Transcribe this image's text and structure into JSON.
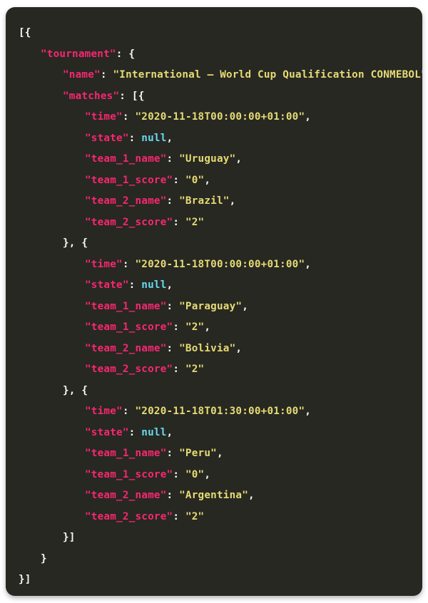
{
  "viewer": {
    "language": "json",
    "theme_name": "monokai",
    "colors": {
      "background": "#272822",
      "key": "#f92672",
      "string": "#e6db74",
      "null_literal": "#66d9ef",
      "punctuation": "#f8f8f2"
    }
  },
  "syntax": {
    "quote": "\"",
    "colon": ": ",
    "comma": ",",
    "open_array_object": "[{",
    "close_object_open_object": "}, {",
    "close_object_array": "}]",
    "close_brace": "}",
    "open_brace": " {",
    "open_array": " [{",
    "null_text": "null"
  },
  "document": {
    "root_open": "[{",
    "tournament_key": "tournament",
    "name_key": "name",
    "name_value": "International – World Cup Qualification CONMEBOL",
    "matches_key": "matches",
    "field_keys": {
      "time": "time",
      "state": "state",
      "team_1_name": "team_1_name",
      "team_1_score": "team_1_score",
      "team_2_name": "team_2_name",
      "team_2_score": "team_2_score"
    },
    "matches": [
      {
        "time": "2020-11-18T00:00:00+01:00",
        "state": null,
        "team_1_name": "Uruguay",
        "team_1_score": "0",
        "team_2_name": "Brazil",
        "team_2_score": "2"
      },
      {
        "time": "2020-11-18T00:00:00+01:00",
        "state": null,
        "team_1_name": "Paraguay",
        "team_1_score": "2",
        "team_2_name": "Bolivia",
        "team_2_score": "2"
      },
      {
        "time": "2020-11-18T01:30:00+01:00",
        "state": null,
        "team_1_name": "Peru",
        "team_1_score": "0",
        "team_2_name": "Argentina",
        "team_2_score": "2"
      }
    ],
    "matches_close": "}]",
    "tournament_close": "}",
    "root_close": "}]"
  }
}
